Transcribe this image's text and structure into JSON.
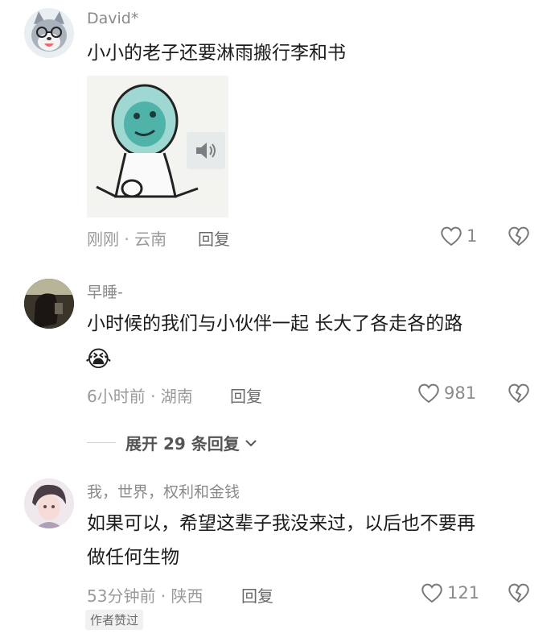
{
  "comments": [
    {
      "username": "David*",
      "text_lines": [
        "小小的老子还要淋雨搬行李和书"
      ],
      "meta": "刚刚 · 云南",
      "reply_label": "回复",
      "likes": "1",
      "avatar_icon": "wolf-cartoon-avatar-icon"
    },
    {
      "username": "早睡-",
      "text_lines": [
        "小时候的我们与小伙伴一起 长大了各走各的路"
      ],
      "emoji": "😭",
      "meta": "6小时前 · 湖南",
      "reply_label": "回复",
      "likes": "981",
      "avatar_icon": "dark-photo-avatar-icon"
    },
    {
      "username": "我，世界，权利和金钱",
      "text_lines": [
        "如果可以，希望这辈子我没来过，以后也不要再",
        "做任何生物"
      ],
      "meta": "53分钟前 · 陕西",
      "reply_label": "回复",
      "likes": "121",
      "badge": "作者赞过",
      "avatar_icon": "anime-avatar-icon"
    }
  ],
  "expand_replies": "展开 29 条回复",
  "colors": {
    "meta": "#9a9a9a",
    "text": "#1b1b1b"
  }
}
